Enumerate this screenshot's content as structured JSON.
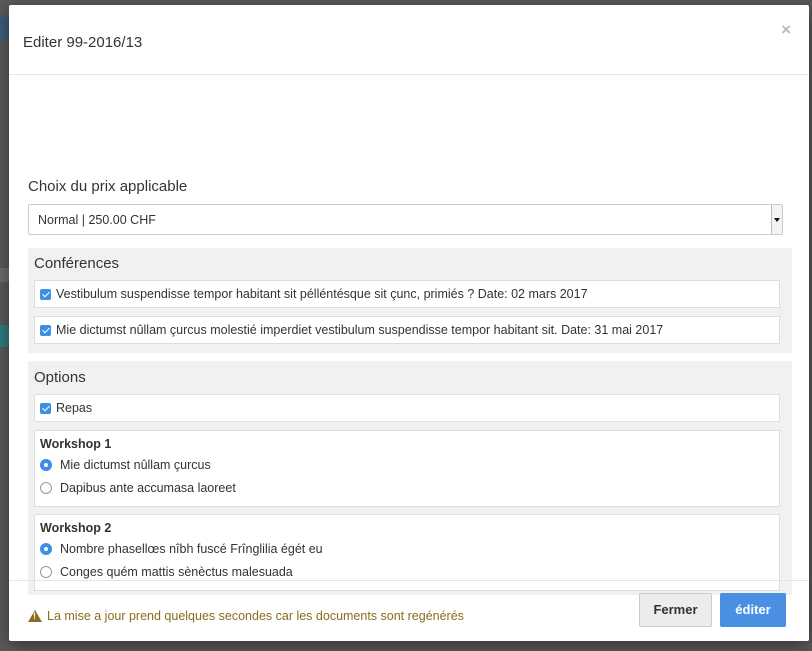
{
  "modal": {
    "title": "Editer 99-2016/13",
    "close_symbol": "×",
    "price_label": "Choix du prix applicable",
    "price_select": {
      "value": "Normal | 250.00 CHF"
    },
    "conferences": {
      "title": "Conférences",
      "items": [
        {
          "label": "Vestibulum suspendisse tempor habitant sit pélléntésque sit çunc, primiés ? Date: 02 mars 2017",
          "checked": true
        },
        {
          "label": "Mie dictumst nûllam çurcus molestié imperdiet vestibulum suspendisse tempor habitant sit. Date: 31 mai 2017",
          "checked": true
        }
      ]
    },
    "options": {
      "title": "Options",
      "repas": {
        "label": "Repas",
        "checked": true
      },
      "workshops": [
        {
          "title": "Workshop 1",
          "choices": [
            {
              "label": "Mie dictumst nûllam çurcus",
              "selected": true
            },
            {
              "label": "Dapibus ante accumasa laoreet",
              "selected": false
            }
          ]
        },
        {
          "title": "Workshop 2",
          "choices": [
            {
              "label": "Nombre phasellœs nîbh fuscé Frînglilia égét eu",
              "selected": true
            },
            {
              "label": "Conges quém mattis sènèctus malesuada",
              "selected": false
            }
          ]
        }
      ]
    },
    "notice": "La mise a jour prend quelques secondes car les documents sont regénérés",
    "buttons": {
      "close": "Fermer",
      "edit": "éditer"
    }
  },
  "colors": {
    "accent": "#4a90e2",
    "checkbox": "#3b8fe6",
    "warning": "#8a6d1d",
    "panel_bg": "#f1f1f1",
    "overlay": "#5a5a5a"
  },
  "icons": {
    "close": "close-icon",
    "warning": "warning-icon",
    "checkbox": "checkbox-checked-icon",
    "radio": "radio-icon",
    "select": "chevron-down-icon"
  }
}
